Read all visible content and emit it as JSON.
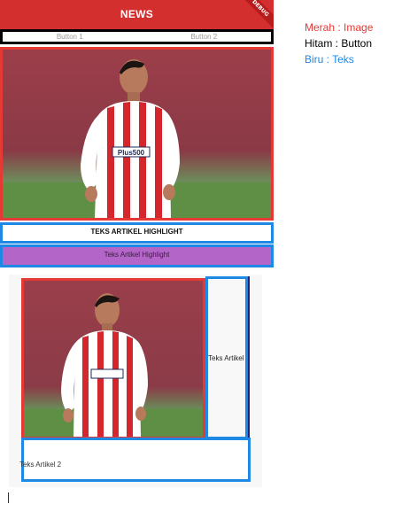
{
  "appbar": {
    "title": "NEWS",
    "debug_banner": "DEBUG"
  },
  "buttons": [
    {
      "label": "Button 1"
    },
    {
      "label": "Button 2"
    }
  ],
  "headline": {
    "text": "TEKS ARTIKEL HIGHLIGHT",
    "subtext": "Teks Artikel Highlight"
  },
  "card": {
    "side_text": "Teks Artikel",
    "bottom_text": "Teks Artikel 2"
  },
  "sponsor_text": "Plus500",
  "legend": {
    "red": "Merah : Image",
    "black": "Hitam : Button",
    "blue": "Biru : Teks"
  },
  "colors": {
    "appbar": "#d32f2f",
    "image_border": "#e53935",
    "button_border": "#000000",
    "text_border": "#1e88e5",
    "highlight_fill": "#b366c8"
  }
}
